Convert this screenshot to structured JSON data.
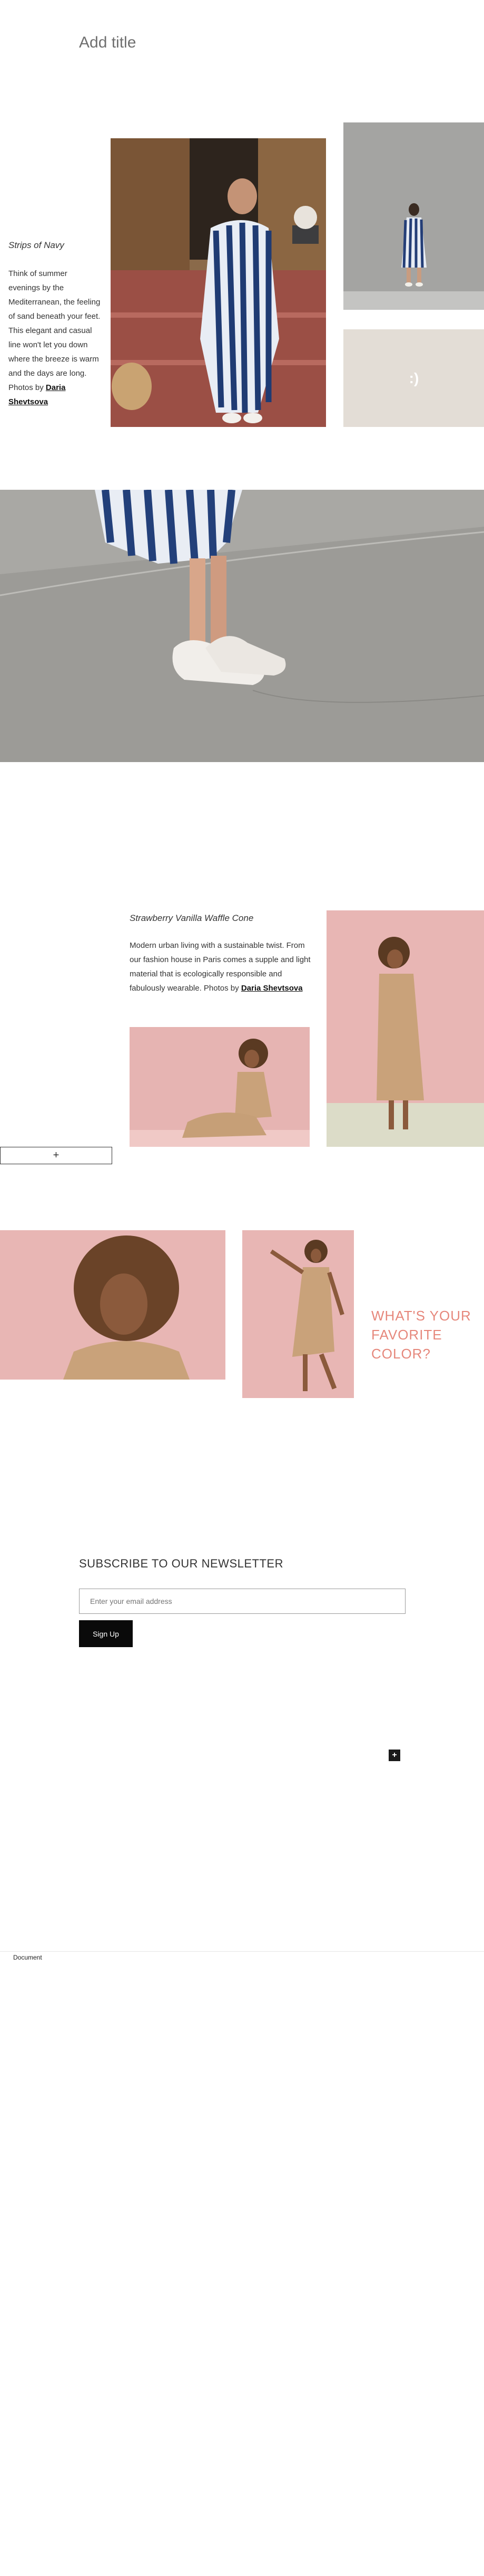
{
  "page": {
    "title": "Add title"
  },
  "story1": {
    "title": "Strips of Navy",
    "text": "Think of summer evenings by the Mediterranean, the feeling of sand beneath your feet. This elegant and casual line won't let you down where the breeze is warm and the days are long. Photos by",
    "author": "Daria Shevtsova",
    "smiley": ":)"
  },
  "story2": {
    "title": "Strawberry Vanilla Waffle Cone",
    "text": "Modern urban living with a sustainable twist. From our fashion house in Paris comes a supple and light material that is ecologically responsible and fabulously wearable. Photos by",
    "author": "Daria Shevtsova",
    "add_label": "+"
  },
  "favorite": {
    "line1": "WHAT'S YOUR",
    "line2": "FAVORITE",
    "line3": "COLOR?"
  },
  "newsletter": {
    "title": "SUBSCRIBE TO OUR NEWSLETTER",
    "placeholder": "Enter your email address",
    "button": "Sign Up"
  },
  "floating": {
    "add_icon": "+"
  },
  "footer": {
    "label": "Document"
  },
  "colors": {
    "accent": "#e6877b",
    "pink_bg": "#e9b5b3",
    "beige_box": "#e3ddd6"
  }
}
